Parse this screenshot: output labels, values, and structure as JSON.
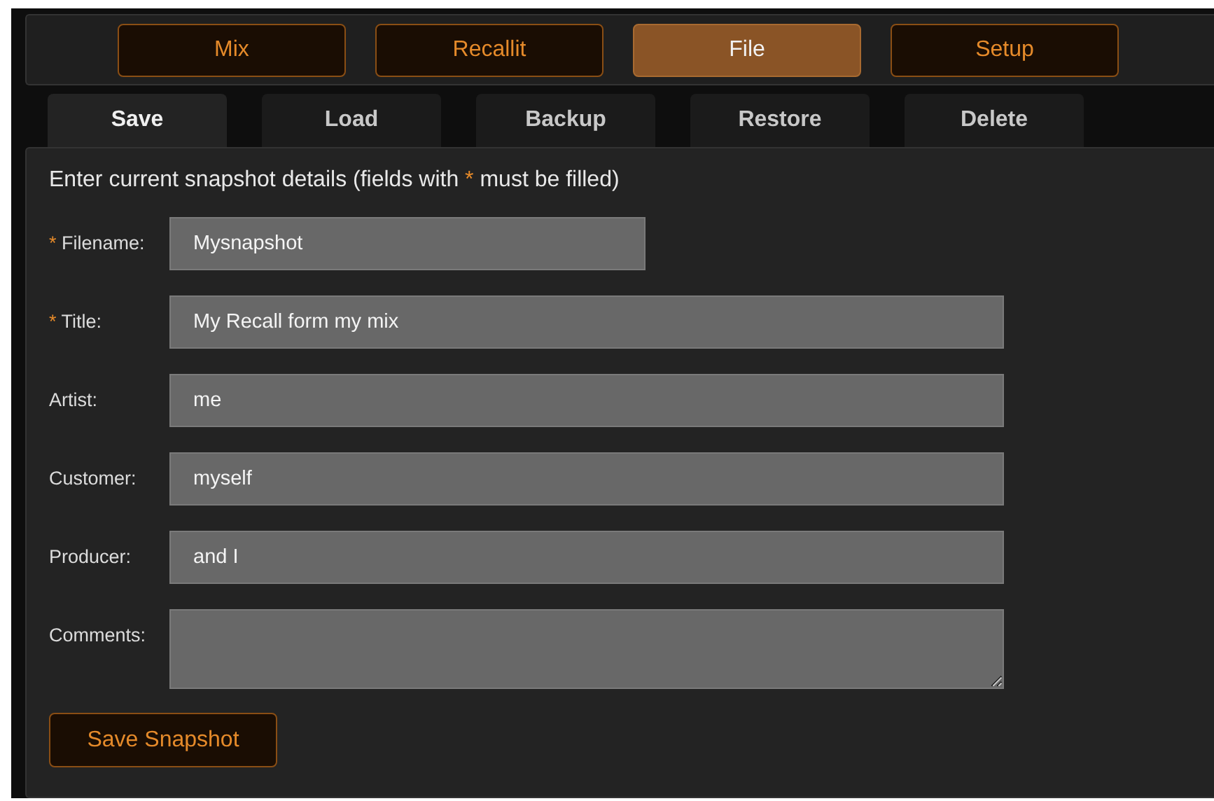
{
  "nav": [
    {
      "label": "Mix",
      "selected": false
    },
    {
      "label": "Recallit",
      "selected": false
    },
    {
      "label": "File",
      "selected": true
    },
    {
      "label": "Setup",
      "selected": false
    }
  ],
  "tabs": [
    {
      "label": "Save",
      "selected": true
    },
    {
      "label": "Load",
      "selected": false
    },
    {
      "label": "Backup",
      "selected": false
    },
    {
      "label": "Restore",
      "selected": false
    },
    {
      "label": "Delete",
      "selected": false
    }
  ],
  "intro": {
    "before": "Enter current snapshot details (fields with ",
    "mark": "*",
    "after": " must be filled)"
  },
  "fields": [
    {
      "label": "Filename:",
      "required_mark": "*",
      "value": "Mysnapshot",
      "kind": "short"
    },
    {
      "label": "Title:",
      "required_mark": "*",
      "value": "My Recall form my mix",
      "kind": "long"
    },
    {
      "label": "Artist:",
      "value": "me",
      "kind": "long"
    },
    {
      "label": "Customer:",
      "value": "myself",
      "kind": "long"
    },
    {
      "label": "Producer:",
      "value": "and I",
      "kind": "long"
    },
    {
      "label": "Comments:",
      "kind": "textarea"
    }
  ],
  "save_button": "Save Snapshot"
}
